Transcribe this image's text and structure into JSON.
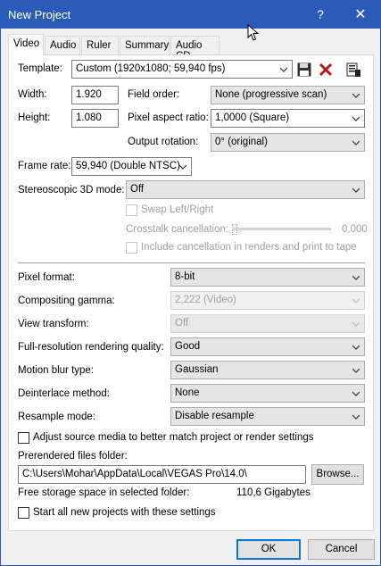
{
  "window": {
    "title": "New Project",
    "help": "?",
    "close": "✕"
  },
  "tabs": [
    "Video",
    "Audio",
    "Ruler",
    "Summary",
    "Audio CD"
  ],
  "template": {
    "label": "Template:",
    "value": "Custom (1920x1080; 59,940 fps)"
  },
  "width": {
    "label": "Width:",
    "value": "1.920"
  },
  "height": {
    "label": "Height:",
    "value": "1.080"
  },
  "field_order": {
    "label": "Field order:",
    "value": "None (progressive scan)"
  },
  "pixel_aspect": {
    "label": "Pixel aspect ratio:",
    "value": "1,0000 (Square)"
  },
  "output_rotation": {
    "label": "Output rotation:",
    "value": "0° (original)"
  },
  "frame_rate": {
    "label": "Frame rate:",
    "value": "59,940 (Double NTSC)"
  },
  "stereo": {
    "label": "Stereoscopic 3D mode:",
    "value": "Off"
  },
  "swap": {
    "label": "Swap Left/Right"
  },
  "crosstalk": {
    "label": "Crosstalk cancellation:",
    "value": "0,000"
  },
  "include_cancel": {
    "label": "Include cancellation in renders and print to tape"
  },
  "pixel_format": {
    "label": "Pixel format:",
    "value": "8-bit"
  },
  "comp_gamma": {
    "label": "Compositing gamma:",
    "value": "2,222 (Video)"
  },
  "view_transform": {
    "label": "View transform:",
    "value": "Off"
  },
  "render_quality": {
    "label": "Full-resolution rendering quality:",
    "value": "Good"
  },
  "motion_blur": {
    "label": "Motion blur type:",
    "value": "Gaussian"
  },
  "deinterlace": {
    "label": "Deinterlace method:",
    "value": "None"
  },
  "resample": {
    "label": "Resample mode:",
    "value": "Disable resample"
  },
  "adjust_source": {
    "label": "Adjust source media to better match project or render settings"
  },
  "prerendered": {
    "label": "Prerendered files folder:",
    "value": "C:\\Users\\Mohar\\AppData\\Local\\VEGAS Pro\\14.0\\",
    "browse": "Browse..."
  },
  "storage": {
    "label": "Free storage space in selected folder:",
    "value": "110,6 Gigabytes"
  },
  "start_all": {
    "label": "Start all new projects with these settings"
  },
  "buttons": {
    "ok": "OK",
    "cancel": "Cancel"
  },
  "colors": {
    "titlebar": "#2b5bb8",
    "focus": "#0078d7"
  }
}
